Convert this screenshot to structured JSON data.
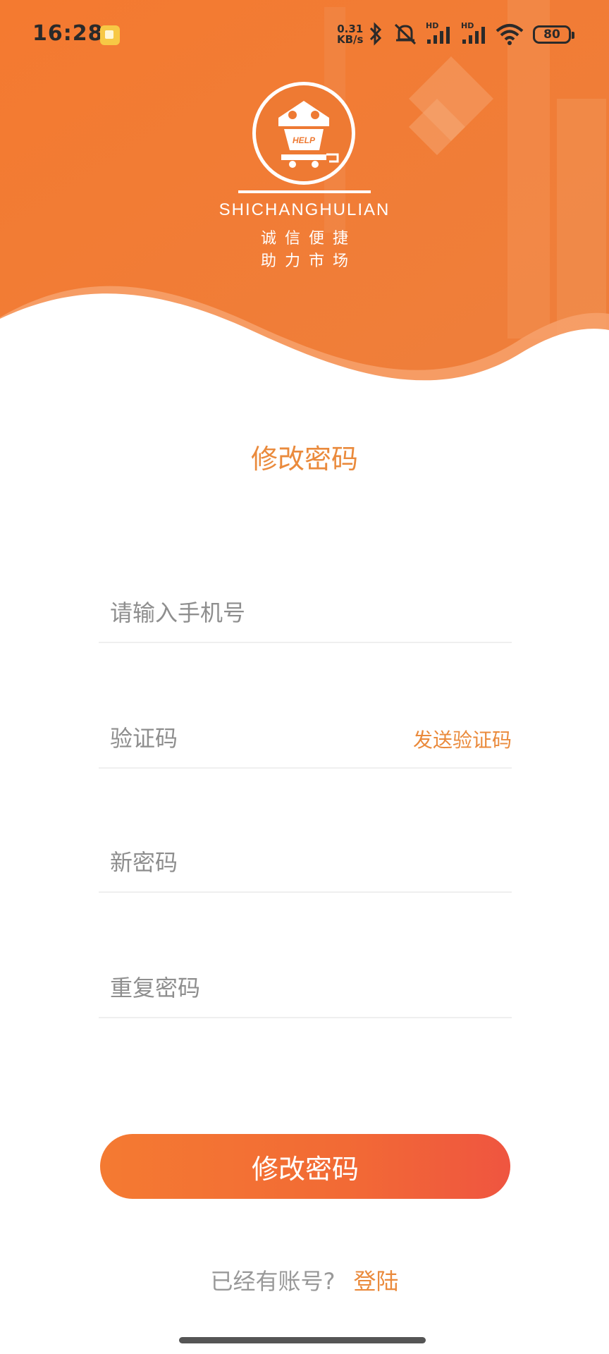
{
  "status_bar": {
    "time": "16:28",
    "net_speed_value": "0.31",
    "net_speed_unit": "KB/s",
    "hd1": "HD",
    "hd2": "HD",
    "battery": "80"
  },
  "logo": {
    "badge_text": "HELP",
    "brand_en": "SHICHANGHULIAN",
    "slogan_line1": "诚信便捷",
    "slogan_line2": "助力市场"
  },
  "page": {
    "title": "修改密码"
  },
  "form": {
    "phone_placeholder": "请输入手机号",
    "code_placeholder": "验证码",
    "send_code_label": "发送验证码",
    "new_password_placeholder": "新密码",
    "repeat_password_placeholder": "重复密码",
    "submit_label": "修改密码"
  },
  "footer": {
    "question": "已经有账号?",
    "login_label": "登陆"
  },
  "colors": {
    "brand_orange": "#f07a34",
    "accent_text": "#ea8a3c",
    "button_gradient_end": "#ef5540"
  }
}
